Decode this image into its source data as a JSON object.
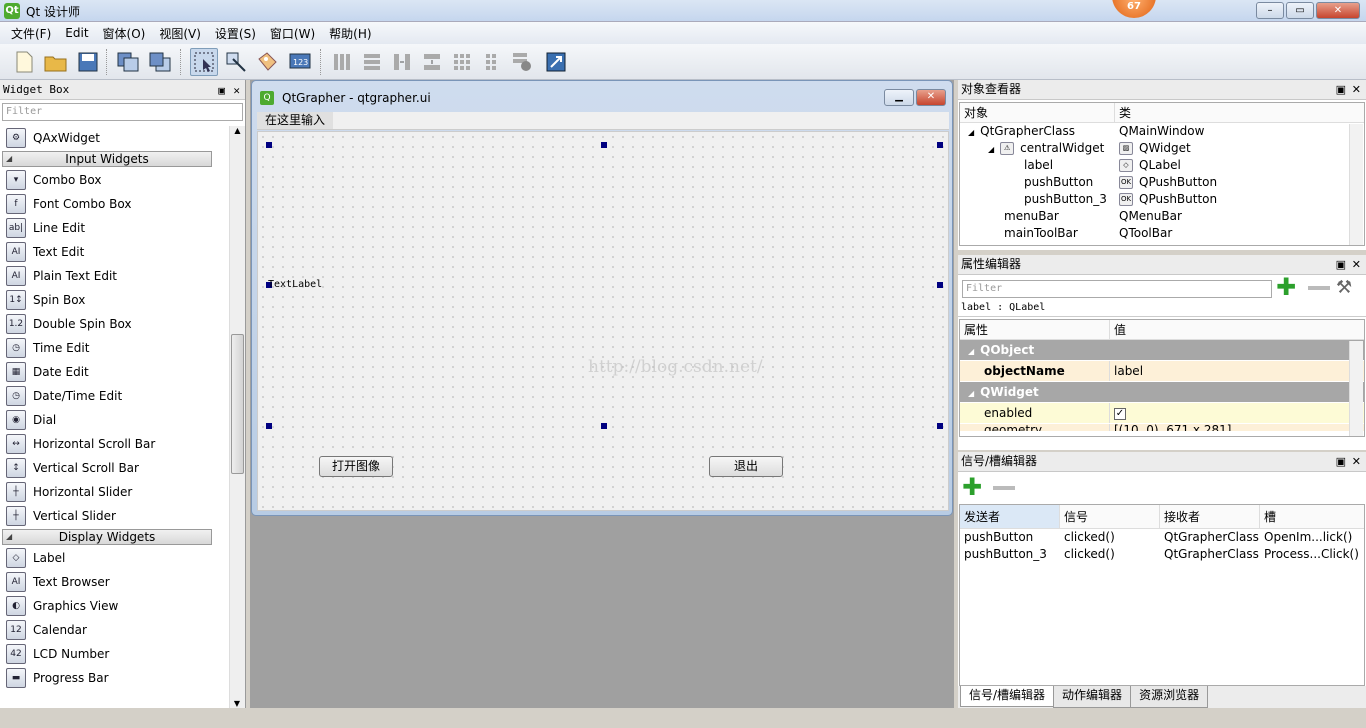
{
  "window": {
    "title": "Qt 设计师",
    "badge": "67",
    "min": "–",
    "max": "▭",
    "close": "✕"
  },
  "menu": [
    "文件(F)",
    "Edit",
    "窗体(O)",
    "视图(V)",
    "设置(S)",
    "窗口(W)",
    "帮助(H)"
  ],
  "toolbar_icons": [
    "new-file-icon",
    "open-folder-icon",
    "save-icon",
    "send-to-back-icon",
    "bring-to-front-icon",
    "edit-widgets-icon",
    "edit-signals-slots-icon",
    "edit-buddies-icon",
    "edit-tab-order-icon",
    "layout-horizontal-icon",
    "layout-vertical-icon",
    "layout-horizontal-splitter-icon",
    "layout-vertical-splitter-icon",
    "layout-grid-icon",
    "layout-form-icon",
    "break-layout-icon",
    "adjust-size-icon"
  ],
  "widget_box": {
    "title": "Widget Box",
    "filter": "Filter",
    "items": [
      {
        "type": "item",
        "label": "QAxWidget",
        "icon": "⚙"
      },
      {
        "type": "cat",
        "label": "Input Widgets"
      },
      {
        "type": "item",
        "label": "Combo Box",
        "icon": "▾"
      },
      {
        "type": "item",
        "label": "Font Combo Box",
        "icon": "f"
      },
      {
        "type": "item",
        "label": "Line Edit",
        "icon": "ab|"
      },
      {
        "type": "item",
        "label": "Text Edit",
        "icon": "AI"
      },
      {
        "type": "item",
        "label": "Plain Text Edit",
        "icon": "AI"
      },
      {
        "type": "item",
        "label": "Spin Box",
        "icon": "1↕"
      },
      {
        "type": "item",
        "label": "Double Spin Box",
        "icon": "1.2"
      },
      {
        "type": "item",
        "label": "Time Edit",
        "icon": "◷"
      },
      {
        "type": "item",
        "label": "Date Edit",
        "icon": "▦"
      },
      {
        "type": "item",
        "label": "Date/Time Edit",
        "icon": "◷"
      },
      {
        "type": "item",
        "label": "Dial",
        "icon": "◉"
      },
      {
        "type": "item",
        "label": "Horizontal Scroll Bar",
        "icon": "↔"
      },
      {
        "type": "item",
        "label": "Vertical Scroll Bar",
        "icon": "↕"
      },
      {
        "type": "item",
        "label": "Horizontal Slider",
        "icon": "┼"
      },
      {
        "type": "item",
        "label": "Vertical Slider",
        "icon": "┼"
      },
      {
        "type": "cat",
        "label": "Display Widgets"
      },
      {
        "type": "item",
        "label": "Label",
        "icon": "◇"
      },
      {
        "type": "item",
        "label": "Text Browser",
        "icon": "AI"
      },
      {
        "type": "item",
        "label": "Graphics View",
        "icon": "◐"
      },
      {
        "type": "item",
        "label": "Calendar",
        "icon": "12"
      },
      {
        "type": "item",
        "label": "LCD Number",
        "icon": "42"
      },
      {
        "type": "item",
        "label": "Progress Bar",
        "icon": "▬"
      }
    ]
  },
  "form": {
    "title": "QtGrapher - qtgrapher.ui",
    "menu_hint": "在这里输入",
    "text_label": "TextLabel",
    "open_button": "打开图像",
    "exit_button": "退出",
    "watermark": "http://blog.csdn.net/"
  },
  "object_inspector": {
    "title": "对象查看器",
    "col_object": "对象",
    "col_class": "类",
    "rows": [
      {
        "object": "QtGrapherClass",
        "class": "QMainWindow"
      },
      {
        "object": "centralWidget",
        "class": "QWidget"
      },
      {
        "object": "label",
        "class": "QLabel"
      },
      {
        "object": "pushButton",
        "class": "QPushButton"
      },
      {
        "object": "pushButton_3",
        "class": "QPushButton"
      },
      {
        "object": "menuBar",
        "class": "QMenuBar"
      },
      {
        "object": "mainToolBar",
        "class": "QToolBar"
      }
    ]
  },
  "property_editor": {
    "title": "属性编辑器",
    "filter": "Filter",
    "context": "label : QLabel",
    "col_prop": "属性",
    "col_value": "值",
    "group1": "QObject",
    "objectName_label": "objectName",
    "objectName_value": "label",
    "group2": "QWidget",
    "enabled_label": "enabled",
    "enabled_check": "✓",
    "geometry_label": "geometry",
    "geometry_value": "[(10, 0), 671 x 281]"
  },
  "signal_editor": {
    "title": "信号/槽编辑器",
    "col_sender": "发送者",
    "col_signal": "信号",
    "col_receiver": "接收者",
    "col_slot": "槽",
    "rows": [
      {
        "sender": "pushButton",
        "signal": "clicked()",
        "receiver": "QtGrapherClass",
        "slot": "OpenIm...lick()"
      },
      {
        "sender": "pushButton_3",
        "signal": "clicked()",
        "receiver": "QtGrapherClass",
        "slot": "Process...Click()"
      }
    ]
  },
  "bottom_tabs": [
    "信号/槽编辑器",
    "动作编辑器",
    "资源浏览器"
  ]
}
